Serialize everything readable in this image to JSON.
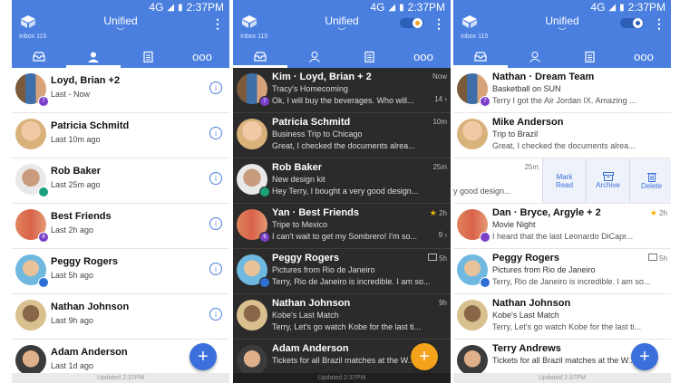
{
  "status": {
    "network": "4G",
    "time": "2:37PM"
  },
  "header": {
    "title": "Unified",
    "inbox_label": "Inbox 115"
  },
  "footer": {
    "updated": "Updated 2:37PM"
  },
  "colors": {
    "accent": "#4a7fe0",
    "fab_blue": "#3b6fdb",
    "fab_orange": "#f4a21b",
    "dark_bg": "#2b2b2b"
  },
  "tabs": [
    {
      "name": "inbox-tab",
      "icon": "inbox-tray-icon"
    },
    {
      "name": "people-tab",
      "icon": "person-icon"
    },
    {
      "name": "tasks-tab",
      "icon": "clipboard-icon"
    },
    {
      "name": "more-tab",
      "icon": "more-icon",
      "label": "ooo"
    }
  ],
  "panel1": {
    "people": [
      {
        "name": "Loyd, Brian +2",
        "sub": "Last - Now",
        "badge": "7",
        "badge_color": "#7b3fc9"
      },
      {
        "name": "Patricia Schmitd",
        "sub": "Last 10m ago",
        "badge": "",
        "badge_color": ""
      },
      {
        "name": "Rob Baker",
        "sub": "Last 25m ago",
        "badge": "",
        "badge_color": "#1aa37a"
      },
      {
        "name": "Best Friends",
        "sub": "Last 2h ago",
        "badge": "6",
        "badge_color": "#7b3fc9"
      },
      {
        "name": "Peggy Rogers",
        "sub": "Last 5h ago",
        "badge": "",
        "badge_color": "#2e6fd6"
      },
      {
        "name": "Nathan Johnson",
        "sub": "Last 9h ago",
        "badge": "",
        "badge_color": ""
      },
      {
        "name": "Adam Anderson",
        "sub": "Last 1d ago",
        "badge": "",
        "badge_color": ""
      }
    ]
  },
  "panel2": {
    "mails": [
      {
        "name": "Kim · Loyd, Brian + 2",
        "subject": "Tracy's Homecoming",
        "preview": "Ok, I will buy the beverages. Who will...",
        "time": "Now",
        "count": "14 ›",
        "badge": "7"
      },
      {
        "name": "Patricia Schmitd",
        "subject": "Business Trip to Chicago",
        "preview": "Great, I checked the documents alrea...",
        "time": "10m",
        "count": "",
        "badge": ""
      },
      {
        "name": "Rob Baker",
        "subject": "New design kit",
        "preview": "Hey Terry, I bought a very good design...",
        "time": "25m",
        "count": "",
        "badge": ""
      },
      {
        "name": "Yan · Best Friends",
        "subject": "Tripe to Mexico",
        "preview": "I can't wait to get my Sombrero! I'm so...",
        "time": "2h",
        "count": "9 ›",
        "badge": "6",
        "star": "★"
      },
      {
        "name": "Peggy Rogers",
        "subject": "Pictures from Rio de Janeiro",
        "preview": "Terry, Rio de Janeiro is incredible. I am so...",
        "time": "5h",
        "count": "",
        "badge": ""
      },
      {
        "name": "Nathan Johnson",
        "subject": "Kobe's Last Match",
        "preview": "Terry, Let's go watch Kobe for the last ti...",
        "time": "9h",
        "count": "",
        "badge": ""
      },
      {
        "name": "Adam Anderson",
        "subject": "Tickets for all Brazil matches at the W...",
        "preview": "",
        "time": "",
        "count": "",
        "badge": ""
      }
    ]
  },
  "panel3": {
    "mails": [
      {
        "name": "Nathan · Dream Team",
        "subject": "Basketball on SUN",
        "preview": "Terry I got the Air Jordan IX. Amazing ...",
        "time": "",
        "count": "",
        "badge": "7"
      },
      {
        "name": "Mike Anderson",
        "subject": "Trip to Brazil",
        "preview": "Great, I checked the documents alrea...",
        "time": "",
        "count": "",
        "badge": ""
      },
      {
        "name": "Dan · Bryce, Argyle + 2",
        "subject": "Movie Night",
        "preview": "I heard that the last Leonardo DiCapr...",
        "time": "2h",
        "count": "",
        "badge": "",
        "star": "★"
      },
      {
        "name": "Peggy Rogers",
        "subject": "Pictures from Rio de Janeiro",
        "preview": "Terry, Rio de Janeiro is incredible. I am so...",
        "time": "5h",
        "count": "",
        "badge": ""
      },
      {
        "name": "Nathan Johnson",
        "subject": "Kobe's Last Match",
        "preview": "Terry, Let's go watch Kobe for the last ti...",
        "time": "",
        "count": "",
        "badge": ""
      },
      {
        "name": "Terry Andrews",
        "subject": "Tickets for all Brazil matches at the W...",
        "preview": "",
        "time": "",
        "count": "",
        "badge": ""
      }
    ],
    "swiped": {
      "time": "25m",
      "preview": "y good design...",
      "actions": {
        "mark_read": "Mark Read",
        "archive": "Archive",
        "delete": "Delete"
      }
    }
  }
}
